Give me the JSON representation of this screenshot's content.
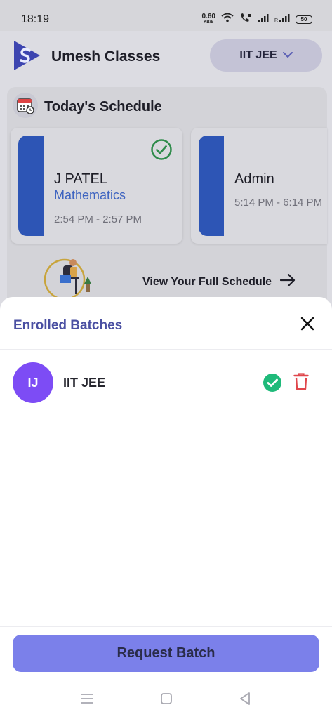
{
  "status_bar": {
    "time": "18:19",
    "net_speed": "0.60",
    "net_unit": "KB/S",
    "battery": "50"
  },
  "header": {
    "app_title": "Umesh Classes",
    "batch_selector": "IIT JEE"
  },
  "schedule": {
    "title": "Today's Schedule",
    "classes": [
      {
        "teacher": "J PATEL",
        "subject": "Mathematics",
        "time": "2:54 PM - 2:57 PM",
        "completed": true
      },
      {
        "teacher": "Admin",
        "subject": "",
        "time": "5:14 PM - 6:14 PM",
        "completed": false
      }
    ],
    "view_full_label": "View Your Full Schedule"
  },
  "sheet": {
    "title": "Enrolled Batches",
    "batches": [
      {
        "initials": "IJ",
        "name": "IIT JEE",
        "verified": true
      }
    ],
    "request_button_label": "Request Batch"
  },
  "colors": {
    "accent": "#4a4fa2",
    "avatar": "#7d4cf5",
    "request_button": "#7b80ea",
    "success": "#1fba7a",
    "danger": "#e0474c",
    "class_stripe": "#2d55b5"
  },
  "icons": {
    "close": "close-icon",
    "verified": "check-circle-icon",
    "delete": "trash-icon",
    "dropdown": "chevron-down-icon",
    "arrow": "arrow-right-icon"
  }
}
